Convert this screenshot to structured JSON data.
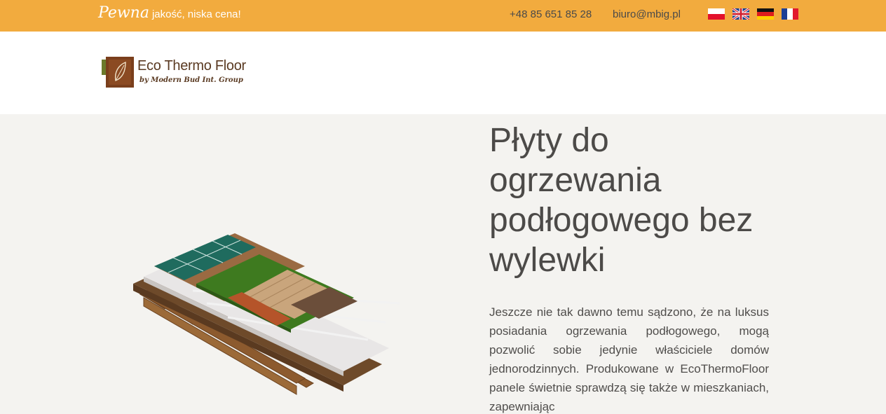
{
  "topbar": {
    "tagline_script": "Pewna",
    "tagline_rest": "jakość, niska cena!",
    "phone": "+48 85 651 85 28",
    "email": "biuro@mbig.pl",
    "languages": [
      "pl-flag-icon",
      "gb-flag-icon",
      "de-flag-icon",
      "fr-flag-icon"
    ]
  },
  "header": {
    "logo_title": "Eco Thermo Floor",
    "logo_subtitle": "by Modern Bud Int. Group"
  },
  "hero": {
    "image": "floor-layers-illustration",
    "heading": "Płyty do ogrzewania podłogowego bez wylewki",
    "body": "Jeszcze nie tak dawno temu sądzono, że na luksus posiadania ogrzewania podłogowego, mogą pozwolić sobie jedynie właściciele domów jednorodzinnych. Produkowane w EcoThermoFloor panele świetnie sprawdzą się także w mieszkaniach, zapewniając"
  },
  "colors": {
    "topbar": "#f2ab3e",
    "background": "#f4f3f0",
    "text": "#4c4a48"
  }
}
